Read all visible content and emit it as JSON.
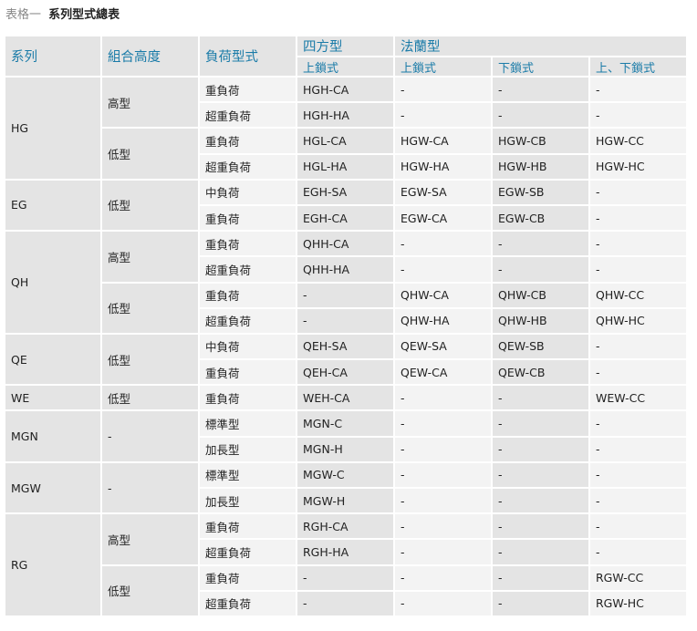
{
  "caption": {
    "prefix": "表格一",
    "title": "系列型式總表"
  },
  "header": {
    "series": "系列",
    "height": "組合高度",
    "load": "負荷型式",
    "square": "四方型",
    "flange": "法蘭型",
    "square_top": "上鎖式",
    "flange_top": "上鎖式",
    "flange_bottom": "下鎖式",
    "flange_both": "上、下鎖式"
  },
  "groups": [
    {
      "series": "HG",
      "sub": [
        {
          "height": "高型",
          "rows": [
            {
              "load": "重負荷",
              "square": "HGH-CA",
              "flange_top": "-",
              "flange_bottom": "-",
              "flange_both": "-"
            },
            {
              "load": "超重負荷",
              "square": "HGH-HA",
              "flange_top": "-",
              "flange_bottom": "-",
              "flange_both": "-"
            }
          ]
        },
        {
          "height": "低型",
          "rows": [
            {
              "load": "重負荷",
              "square": "HGL-CA",
              "flange_top": "HGW-CA",
              "flange_bottom": "HGW-CB",
              "flange_both": "HGW-CC"
            },
            {
              "load": "超重負荷",
              "square": "HGL-HA",
              "flange_top": "HGW-HA",
              "flange_bottom": "HGW-HB",
              "flange_both": "HGW-HC"
            }
          ]
        }
      ]
    },
    {
      "series": "EG",
      "sub": [
        {
          "height": "低型",
          "rows": [
            {
              "load": "中負荷",
              "square": "EGH-SA",
              "flange_top": "EGW-SA",
              "flange_bottom": "EGW-SB",
              "flange_both": "-"
            },
            {
              "load": "重負荷",
              "square": "EGH-CA",
              "flange_top": "EGW-CA",
              "flange_bottom": "EGW-CB",
              "flange_both": "-"
            }
          ]
        }
      ]
    },
    {
      "series": "QH",
      "sub": [
        {
          "height": "高型",
          "rows": [
            {
              "load": "重負荷",
              "square": "QHH-CA",
              "flange_top": "-",
              "flange_bottom": "-",
              "flange_both": "-"
            },
            {
              "load": "超重負荷",
              "square": "QHH-HA",
              "flange_top": "-",
              "flange_bottom": "-",
              "flange_both": "-"
            }
          ]
        },
        {
          "height": "低型",
          "rows": [
            {
              "load": "重負荷",
              "square": "-",
              "flange_top": "QHW-CA",
              "flange_bottom": "QHW-CB",
              "flange_both": "QHW-CC"
            },
            {
              "load": "超重負荷",
              "square": "-",
              "flange_top": "QHW-HA",
              "flange_bottom": "QHW-HB",
              "flange_both": "QHW-HC"
            }
          ]
        }
      ]
    },
    {
      "series": "QE",
      "sub": [
        {
          "height": "低型",
          "rows": [
            {
              "load": "中負荷",
              "square": "QEH-SA",
              "flange_top": "QEW-SA",
              "flange_bottom": "QEW-SB",
              "flange_both": "-"
            },
            {
              "load": "重負荷",
              "square": "QEH-CA",
              "flange_top": "QEW-CA",
              "flange_bottom": "QEW-CB",
              "flange_both": "-"
            }
          ]
        }
      ]
    },
    {
      "series": "WE",
      "sub": [
        {
          "height": "低型",
          "rows": [
            {
              "load": "重負荷",
              "square": "WEH-CA",
              "flange_top": "-",
              "flange_bottom": "-",
              "flange_both": "WEW-CC"
            }
          ]
        }
      ]
    },
    {
      "series": "MGN",
      "sub": [
        {
          "height": "-",
          "rows": [
            {
              "load": "標準型",
              "square": "MGN-C",
              "flange_top": "-",
              "flange_bottom": "-",
              "flange_both": "-"
            },
            {
              "load": "加長型",
              "square": "MGN-H",
              "flange_top": "-",
              "flange_bottom": "-",
              "flange_both": "-"
            }
          ]
        }
      ]
    },
    {
      "series": "MGW",
      "sub": [
        {
          "height": "-",
          "rows": [
            {
              "load": "標準型",
              "square": "MGW-C",
              "flange_top": "-",
              "flange_bottom": "-",
              "flange_both": "-"
            },
            {
              "load": "加長型",
              "square": "MGW-H",
              "flange_top": "-",
              "flange_bottom": "-",
              "flange_both": "-"
            }
          ]
        }
      ]
    },
    {
      "series": "RG",
      "sub": [
        {
          "height": "高型",
          "rows": [
            {
              "load": "重負荷",
              "square": "RGH-CA",
              "flange_top": "-",
              "flange_bottom": "-",
              "flange_both": "-"
            },
            {
              "load": "超重負荷",
              "square": "RGH-HA",
              "flange_top": "-",
              "flange_bottom": "-",
              "flange_both": "-"
            }
          ]
        },
        {
          "height": "低型",
          "rows": [
            {
              "load": "重負荷",
              "square": "-",
              "flange_top": "-",
              "flange_bottom": "-",
              "flange_both": "RGW-CC"
            },
            {
              "load": "超重負荷",
              "square": "-",
              "flange_top": "-",
              "flange_bottom": "-",
              "flange_both": "RGW-HC"
            }
          ]
        }
      ]
    }
  ]
}
